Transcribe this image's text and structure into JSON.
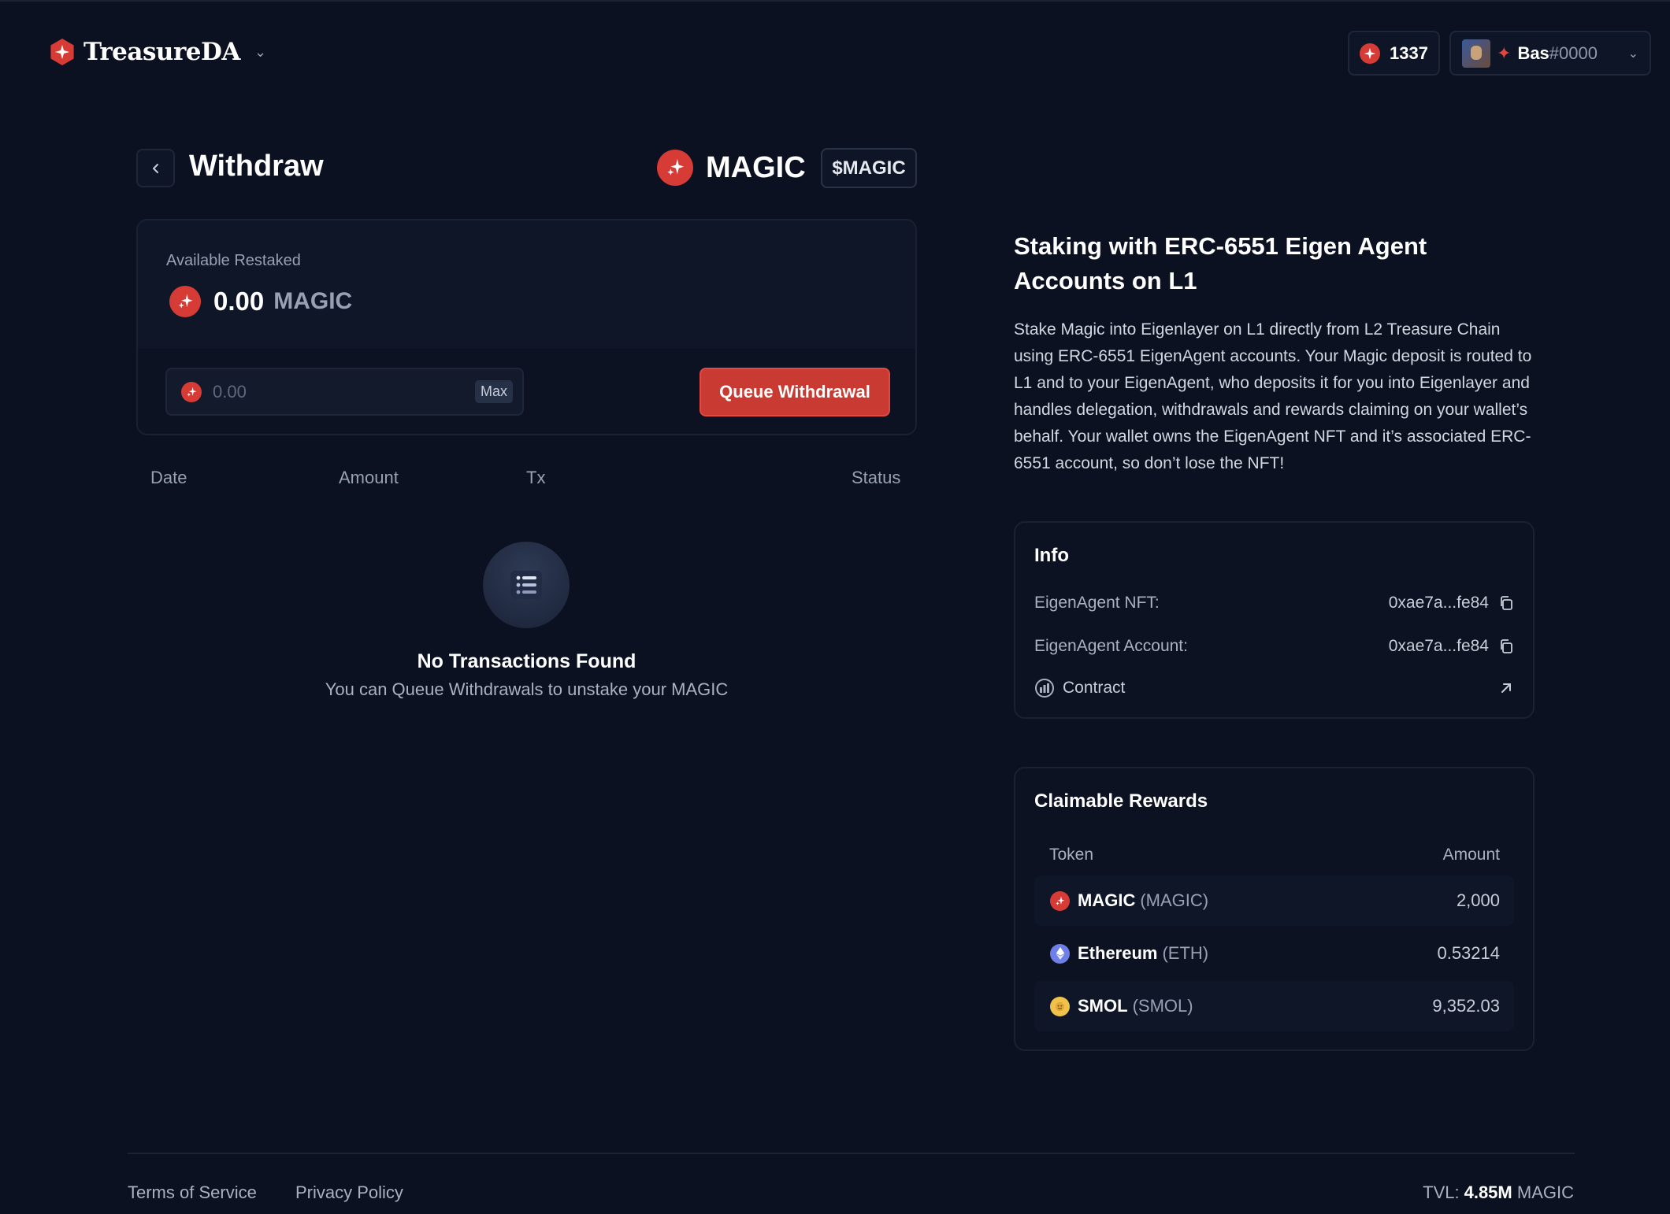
{
  "header": {
    "brand": "TreasureDA",
    "balance": "1337",
    "user_name": "Bas",
    "user_tag": "#0000"
  },
  "page": {
    "title": "Withdraw",
    "token_name": "MAGIC",
    "token_ticker": "$MAGIC"
  },
  "withdraw_card": {
    "available_label": "Available Restaked",
    "available_amount": "0.00",
    "available_unit": "MAGIC",
    "input_placeholder": "0.00",
    "max_label": "Max",
    "queue_label": "Queue Withdrawal"
  },
  "transactions": {
    "columns": [
      "Date",
      "Amount",
      "Tx",
      "Status"
    ],
    "empty_title": "No Transactions Found",
    "empty_subtitle": "You can Queue Withdrawals to unstake your MAGIC"
  },
  "side": {
    "title": "Staking with ERC-6551 Eigen Agent Accounts on L1",
    "description": "Stake Magic into Eigenlayer on L1 directly from L2 Treasure Chain using ERC-6551 EigenAgent accounts. Your Magic deposit is routed to L1 and to your EigenAgent, who deposits it for you into Eigenlayer and handles delegation, withdrawals and rewards claiming on your wallet’s behalf. Your wallet owns the EigenAgent NFT and it’s associated ERC-6551 account, so don’t lose the NFT!"
  },
  "info": {
    "title": "Info",
    "nft_label": "EigenAgent NFT:",
    "nft_value": "0xae7a...fe84",
    "account_label": "EigenAgent Account:",
    "account_value": "0xae7a...fe84",
    "contract_label": "Contract"
  },
  "rewards": {
    "title": "Claimable Rewards",
    "col_token": "Token",
    "col_amount": "Amount",
    "rows": [
      {
        "name": "MAGIC",
        "symbol": "(MAGIC)",
        "amount": "2,000",
        "icon": "magic-coin",
        "color": "#d63b36"
      },
      {
        "name": "Ethereum",
        "symbol": "(ETH)",
        "amount": "0.53214",
        "icon": "eth-coin",
        "color": "#6f7fe8"
      },
      {
        "name": "SMOL",
        "symbol": "(SMOL)",
        "amount": "9,352.03",
        "icon": "smol-coin",
        "color": "#f1c24b"
      }
    ]
  },
  "footer": {
    "terms": "Terms of Service",
    "privacy": "Privacy Policy",
    "tvl_label": "TVL:",
    "tvl_value": "4.85M",
    "tvl_unit": "MAGIC"
  }
}
